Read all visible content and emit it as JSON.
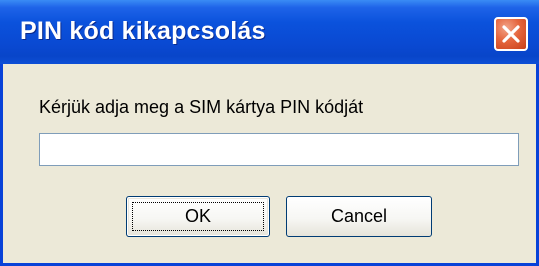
{
  "window": {
    "title": "PIN kód kikapcsolás",
    "close_icon": "close-icon"
  },
  "dialog": {
    "prompt": "Kérjük adja meg a SIM kártya PIN kódját",
    "pin_value": "",
    "pin_placeholder": ""
  },
  "buttons": {
    "ok_label": "OK",
    "cancel_label": "Cancel"
  },
  "colors": {
    "titlebar": "#0A49D2",
    "close_button": "#E5663E",
    "dialog_background": "#ECE9D8",
    "button_border": "#003C74"
  }
}
